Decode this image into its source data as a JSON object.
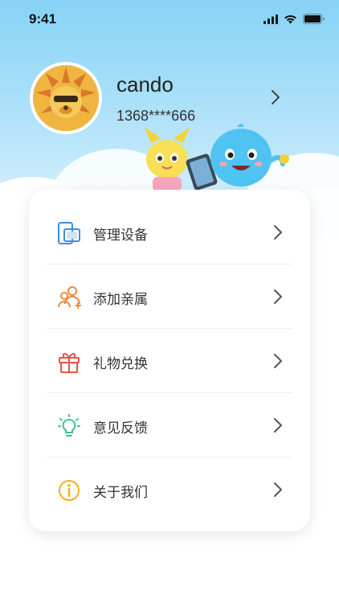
{
  "status_bar": {
    "time": "9:41"
  },
  "profile": {
    "username": "cando",
    "phone": "1368****666"
  },
  "menu": {
    "items": [
      {
        "label": "管理设备",
        "icon": "device-icon",
        "color": "#3d8fe0"
      },
      {
        "label": "添加亲属",
        "icon": "family-icon",
        "color": "#f08a3c"
      },
      {
        "label": "礼物兑换",
        "icon": "gift-icon",
        "color": "#e9524a"
      },
      {
        "label": "意见反馈",
        "icon": "lightbulb-icon",
        "color": "#3cc58a"
      },
      {
        "label": "关于我们",
        "icon": "info-icon",
        "color": "#f2b01e"
      }
    ]
  }
}
